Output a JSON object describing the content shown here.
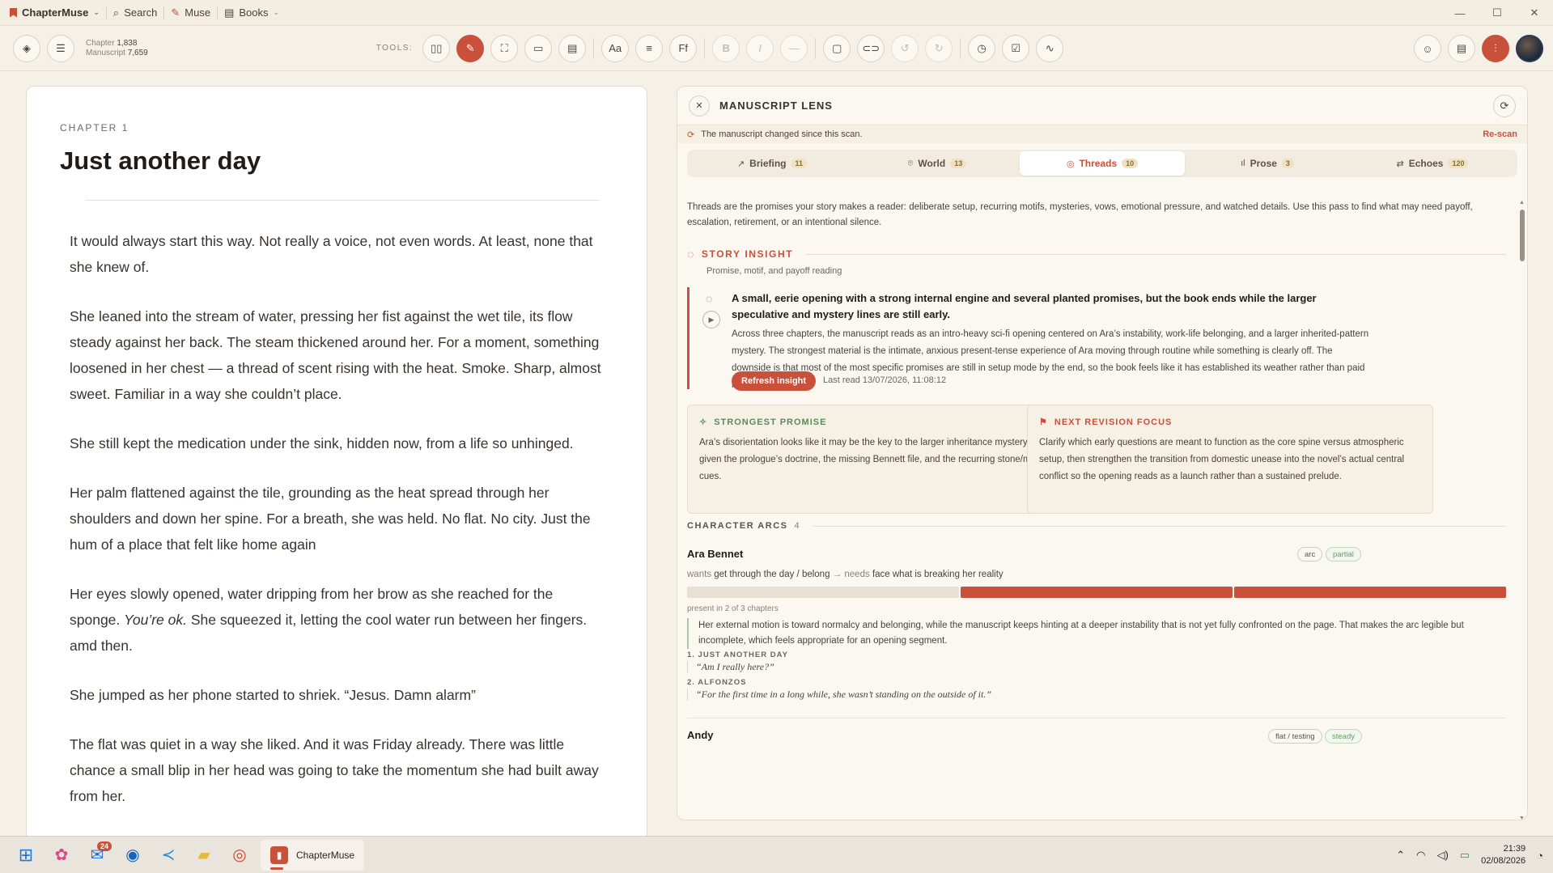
{
  "titlebar": {
    "app_name": "ChapterMuse",
    "search": "Search",
    "muse": "Muse",
    "books": "Books"
  },
  "toolbar": {
    "chapter_label": "Chapter",
    "chapter_count": "1,838",
    "manuscript_label": "Manuscript",
    "manuscript_count": "7,659",
    "tools_label": "TOOLS:",
    "btn_aa": "Aa",
    "btn_ff": "Ff",
    "btn_b": "B",
    "btn_i": "I"
  },
  "chapter": {
    "label": "CHAPTER 1",
    "title": "Just another day",
    "paragraphs": [
      "It would always start this way. Not really a voice, not even words. At least, none that she knew of.",
      "She leaned into the stream of water, pressing her fist against the wet tile, its flow steady against her back. The steam thickened around her. For a moment, something loosened in her chest — a thread of scent rising with the heat. Smoke. Sharp, almost sweet. Familiar in a way she couldn’t place.",
      "She still kept the medication under the sink, hidden now, from a life so unhinged.",
      "Her palm flattened against the tile, grounding as the heat spread through her shoulders and down her spine. For a breath, she was held. No flat. No city. Just the hum of a place that felt like home again"
    ],
    "p5_a": "Her eyes slowly opened, water dripping from her brow as she reached for the sponge. ",
    "p5_i": "You’re ok.",
    "p5_b": " She squeezed it, letting the cool water run between her fingers. amd then.",
    "p6": "She jumped as her phone started to shriek. “Jesus. Damn alarm”",
    "p7": "The flat was quiet in a way she liked. And it was Friday already. There was little chance a small blip in her head was going to take the momentum she had built away from her."
  },
  "panel": {
    "title": "MANUSCRIPT LENS",
    "banner": "The manuscript changed since this scan.",
    "rescan": "Re-scan",
    "tabs": [
      {
        "label": "Briefing",
        "count": "11",
        "icon": "↗"
      },
      {
        "label": "World",
        "count": "13",
        "icon": "⌾"
      },
      {
        "label": "Threads",
        "count": "10",
        "icon": "◎"
      },
      {
        "label": "Prose",
        "count": "3",
        "icon": "ıl"
      },
      {
        "label": "Echoes",
        "count": "120",
        "icon": "⇄"
      }
    ],
    "intro": "Threads are the promises your story makes a reader: deliberate setup, recurring motifs, mysteries, vows, emotional pressure, and watched details. Use this pass to find what may need payoff, escalation, retirement, or an intentional silence.",
    "story_insight": {
      "title": "STORY INSIGHT",
      "subtitle": "Promise, motif, and payoff reading",
      "headline": "A small, eerie opening with a strong internal engine and several planted promises, but the book ends while the larger speculative and mystery lines are still early.",
      "body": "Across three chapters, the manuscript reads as an intro-heavy sci-fi opening centered on Ara’s instability, work-life belonging, and a larger inherited-pattern mystery. The strongest material is the intimate, anxious present-tense experience of Ara moving through routine while something is clearly off. The downside is that most of the most specific promises are still in setup mode by the end, so the book feels like it has established its weather rather than paid it off.",
      "button": "Refresh insight",
      "last_read": "Last read 13/07/2026, 11:08:12"
    },
    "strongest": {
      "title": "STRONGEST PROMISE",
      "body": "Ara’s disorientation looks like it may be the key to the larger inheritance mystery, especially given the prologue’s doctrine, the missing Bennett file, and the recurring stone/medication cues."
    },
    "next_focus": {
      "title": "NEXT REVISION FOCUS",
      "body": "Clarify which early questions are meant to function as the core spine versus atmospheric setup, then strengthen the transition from domestic unease into the novel’s actual central conflict so the opening reads as a launch rather than a sustained prelude."
    },
    "arcs": {
      "title": "CHARACTER ARCS",
      "count": "4",
      "ara": {
        "name": "Ara Bennet",
        "pill1": "arc",
        "pill2": "partial",
        "wants_k": "wants",
        "wants_v": "get through the day / belong",
        "arrow": "→",
        "needs_k": "needs",
        "needs_v": "face what is breaking her reality",
        "present": "present in 2 of 3 chapters",
        "note": "Her external motion is toward normalcy and belonging, while the manuscript keeps hinting at a deeper instability that is not yet fully confronted on the page. That makes the arc legible but incomplete, which feels appropriate for an opening segment.",
        "q1_label": "1. JUST ANOTHER DAY",
        "q1": "“Am I really here?”",
        "q2_label": "2. ALFONZOS",
        "q2": "“For the first time in a long while, she wasn’t standing on the outside of it.”"
      },
      "andy": {
        "name": "Andy",
        "pill1": "flat / testing",
        "pill2": "steady"
      }
    }
  },
  "taskbar": {
    "mail_badge": "24",
    "app_label": "ChapterMuse",
    "time": "21:39",
    "date": "02/08/2026"
  },
  "colors": {
    "accent": "#c9503a",
    "arc_empty": "#e8e0d3",
    "arc_filled": "#c9503a",
    "background": "#f6f1e7"
  }
}
